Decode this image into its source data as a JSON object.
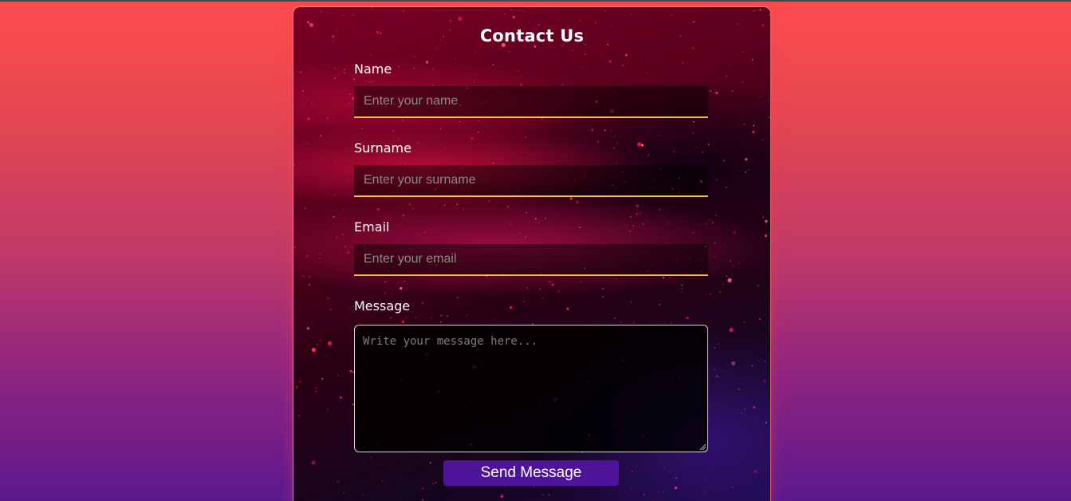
{
  "form": {
    "title": "Contact Us",
    "fields": [
      {
        "label": "Name",
        "placeholder": "Enter your name",
        "value": ""
      },
      {
        "label": "Surname",
        "placeholder": "Enter your surname",
        "value": ""
      },
      {
        "label": "Email",
        "placeholder": "Enter your email",
        "value": ""
      }
    ],
    "message": {
      "label": "Message",
      "placeholder": "Write your message here...",
      "value": ""
    },
    "submit_label": "Send Message"
  },
  "colors": {
    "page_gradient_top": "#ff4d4d",
    "page_gradient_bottom": "#5b198e",
    "input_underline": "#f5c04a",
    "button": "#4d1499",
    "text": "#ffffff"
  }
}
